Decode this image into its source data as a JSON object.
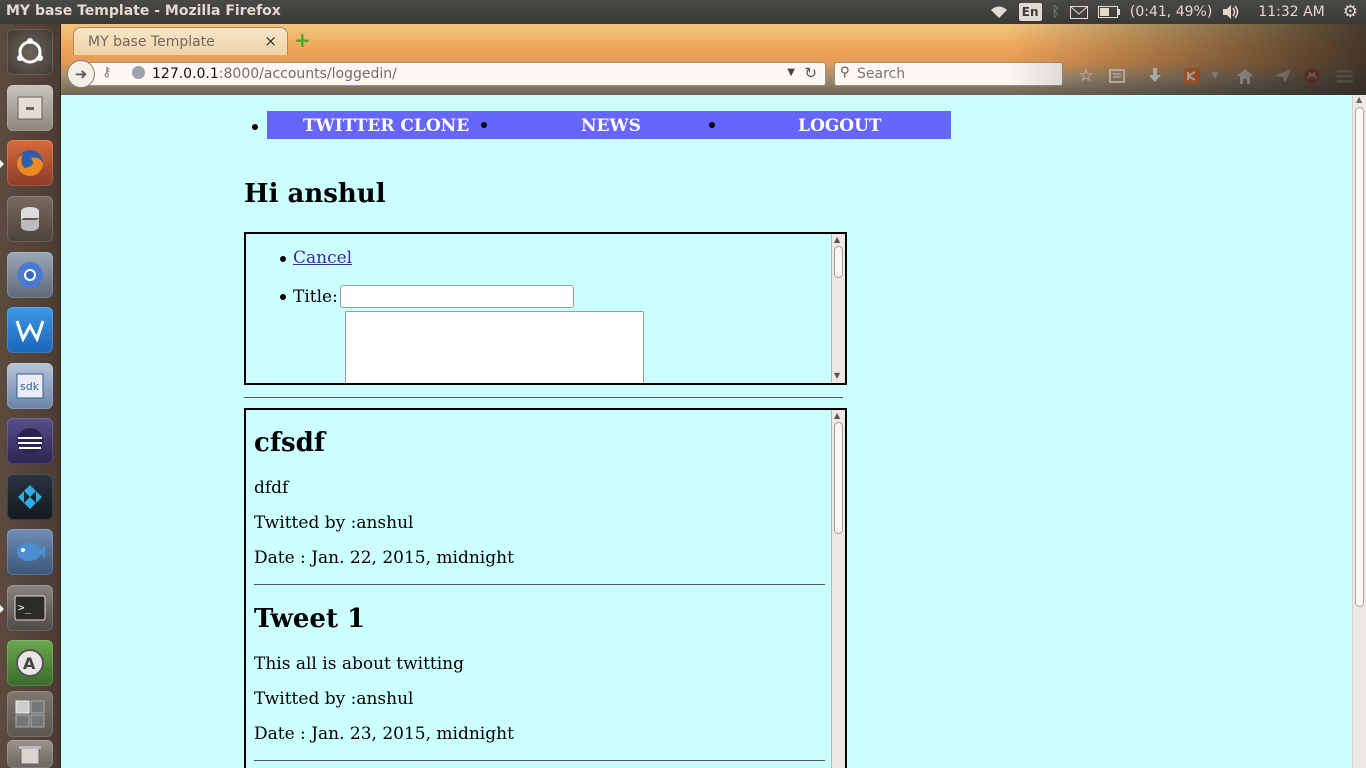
{
  "system": {
    "window_title": "MY base Template - Mozilla Firefox",
    "keyboard_layout": "En",
    "battery": "(0:41, 49%)",
    "clock": "11:32 AM"
  },
  "launcher": {
    "items": [
      "dash-home",
      "files",
      "firefox",
      "python",
      "chromium",
      "wps-writer",
      "android-sdk",
      "eclipse",
      "kodi",
      "bluefish",
      "terminal",
      "software-updater",
      "workspace-switcher",
      "trash"
    ]
  },
  "browser": {
    "tab_title": "MY base Template",
    "tab_close": "×",
    "new_tab": "+",
    "url_host": "127.0.0.1",
    "url_rest": ":8000/accounts/loggedin/",
    "search_placeholder": "Search"
  },
  "page": {
    "nav": {
      "home": "TWITTER CLONE",
      "news": "NEWS",
      "logout": "LOGOUT",
      "bg_color": "#6666ff"
    },
    "greeting": "Hi anshul",
    "form": {
      "cancel_label": "Cancel",
      "title_label": "Title:",
      "title_value": "",
      "body_value": ""
    },
    "tweets": [
      {
        "title": "cfsdf",
        "body": "dfdf",
        "author": "Twitted by :anshul",
        "date": "Date : Jan. 22, 2015, midnight"
      },
      {
        "title": "Tweet 1",
        "body": "This all is about twitting",
        "author": "Twitted by :anshul",
        "date": "Date : Jan. 23, 2015, midnight"
      }
    ],
    "background": "#ccffff"
  }
}
